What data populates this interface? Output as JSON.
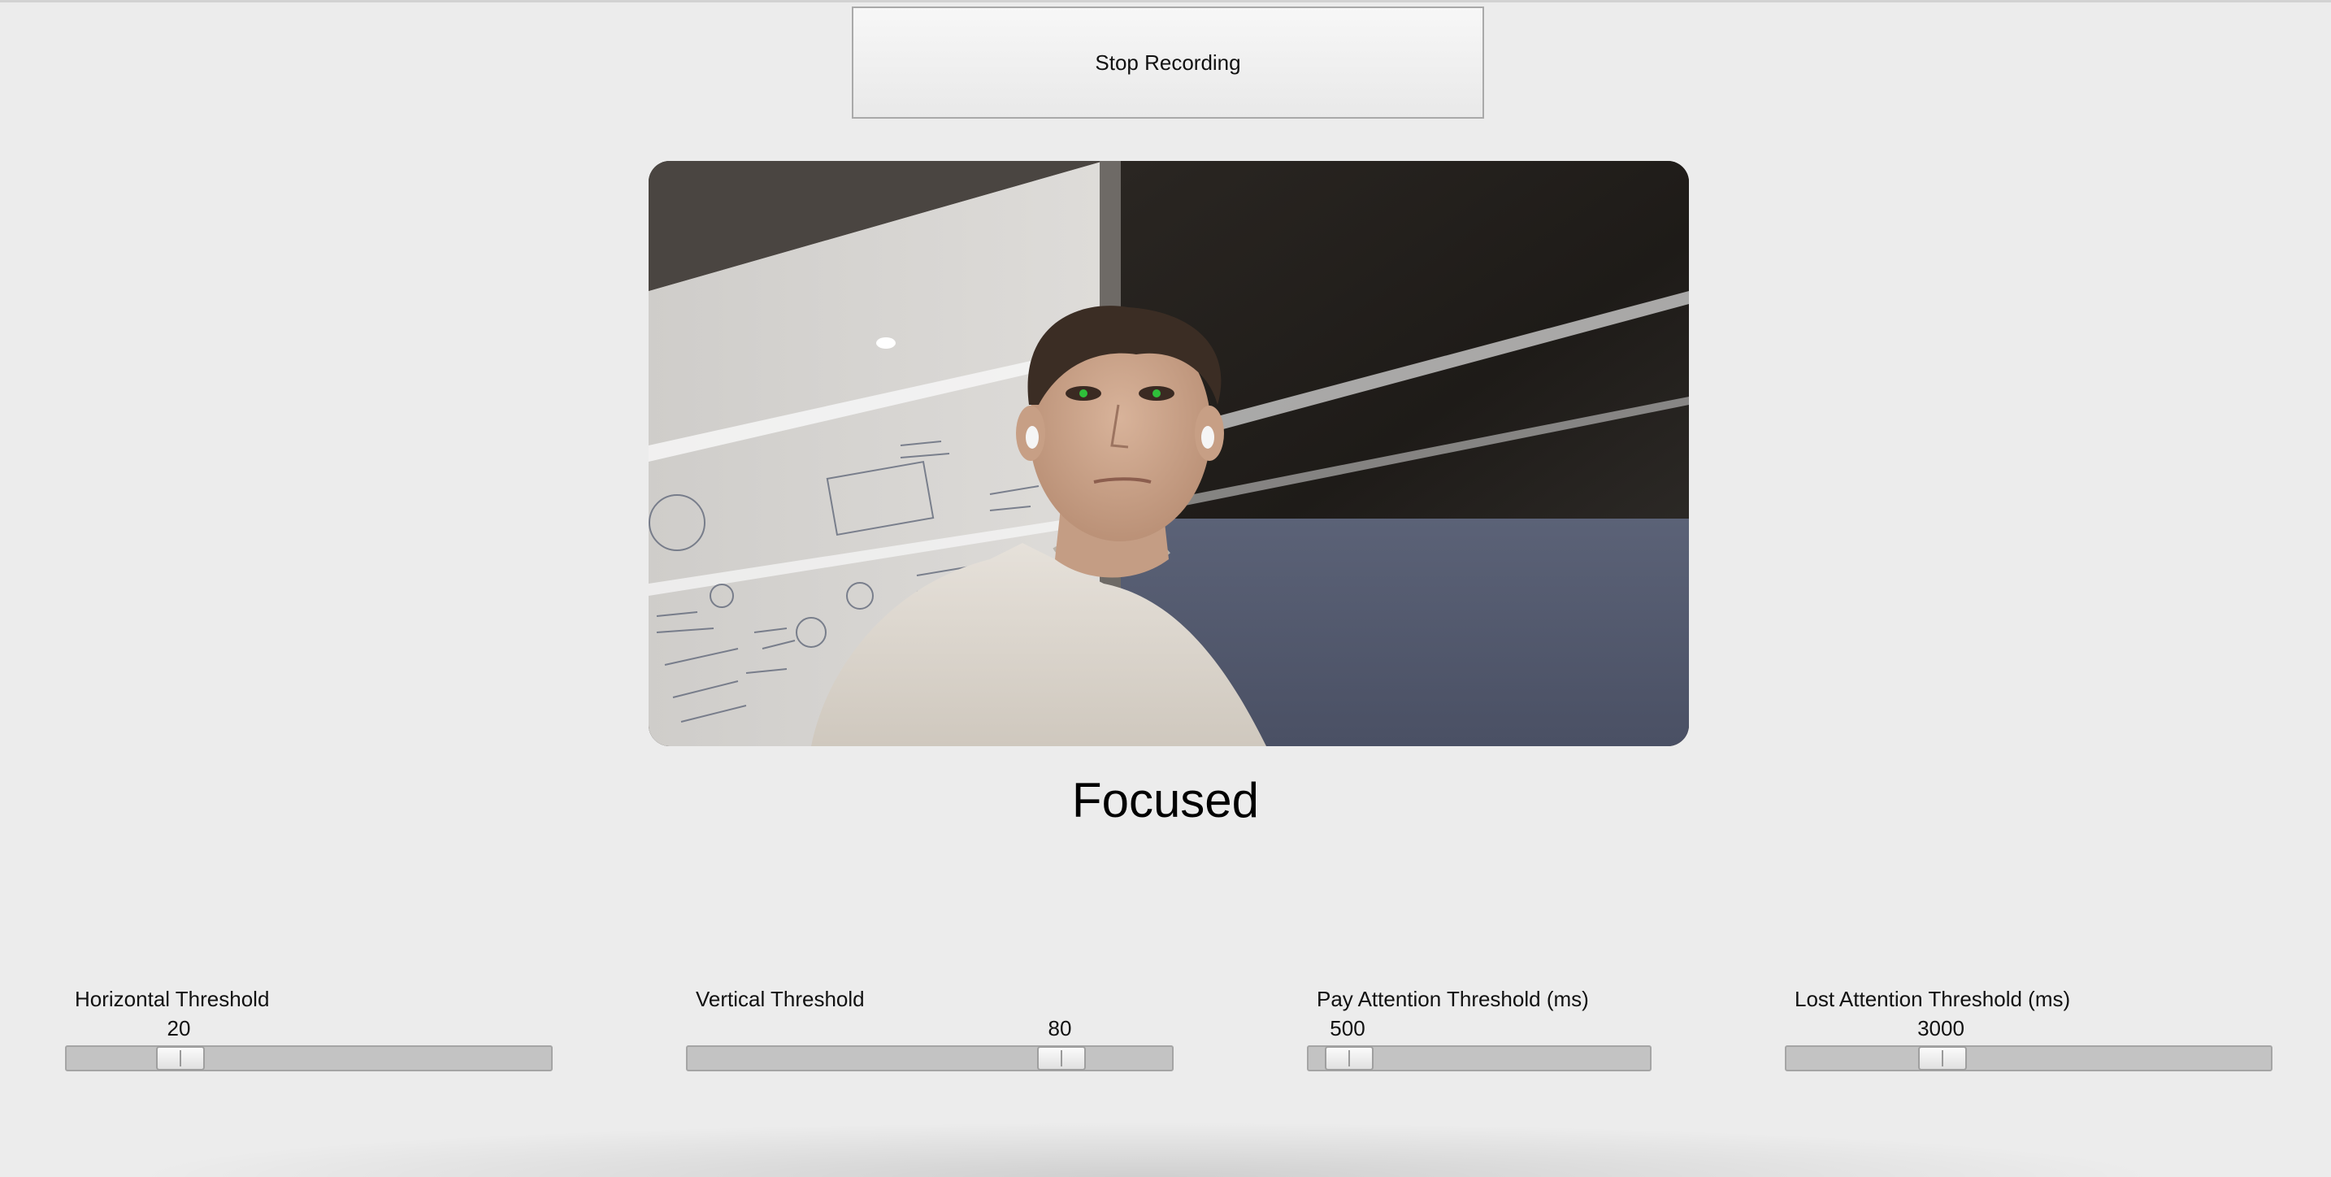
{
  "recording_button": {
    "label": "Stop Recording"
  },
  "video_feed": {
    "description_icon": "webcam-frame"
  },
  "status": {
    "text": "Focused"
  },
  "sliders": [
    {
      "label": "Horizontal Threshold",
      "value": "20",
      "fraction": 0.23
    },
    {
      "label": "Vertical Threshold",
      "value": "80",
      "fraction": 0.77
    },
    {
      "label": "Pay Attention Threshold (ms)",
      "value": "500",
      "fraction": 0.12
    },
    {
      "label": "Lost Attention Threshold (ms)",
      "value": "3000",
      "fraction": 0.32
    }
  ],
  "colors": {
    "background": "#ececec",
    "trough": "#c3c3c3",
    "eye_marker": "#2fbf3a"
  }
}
